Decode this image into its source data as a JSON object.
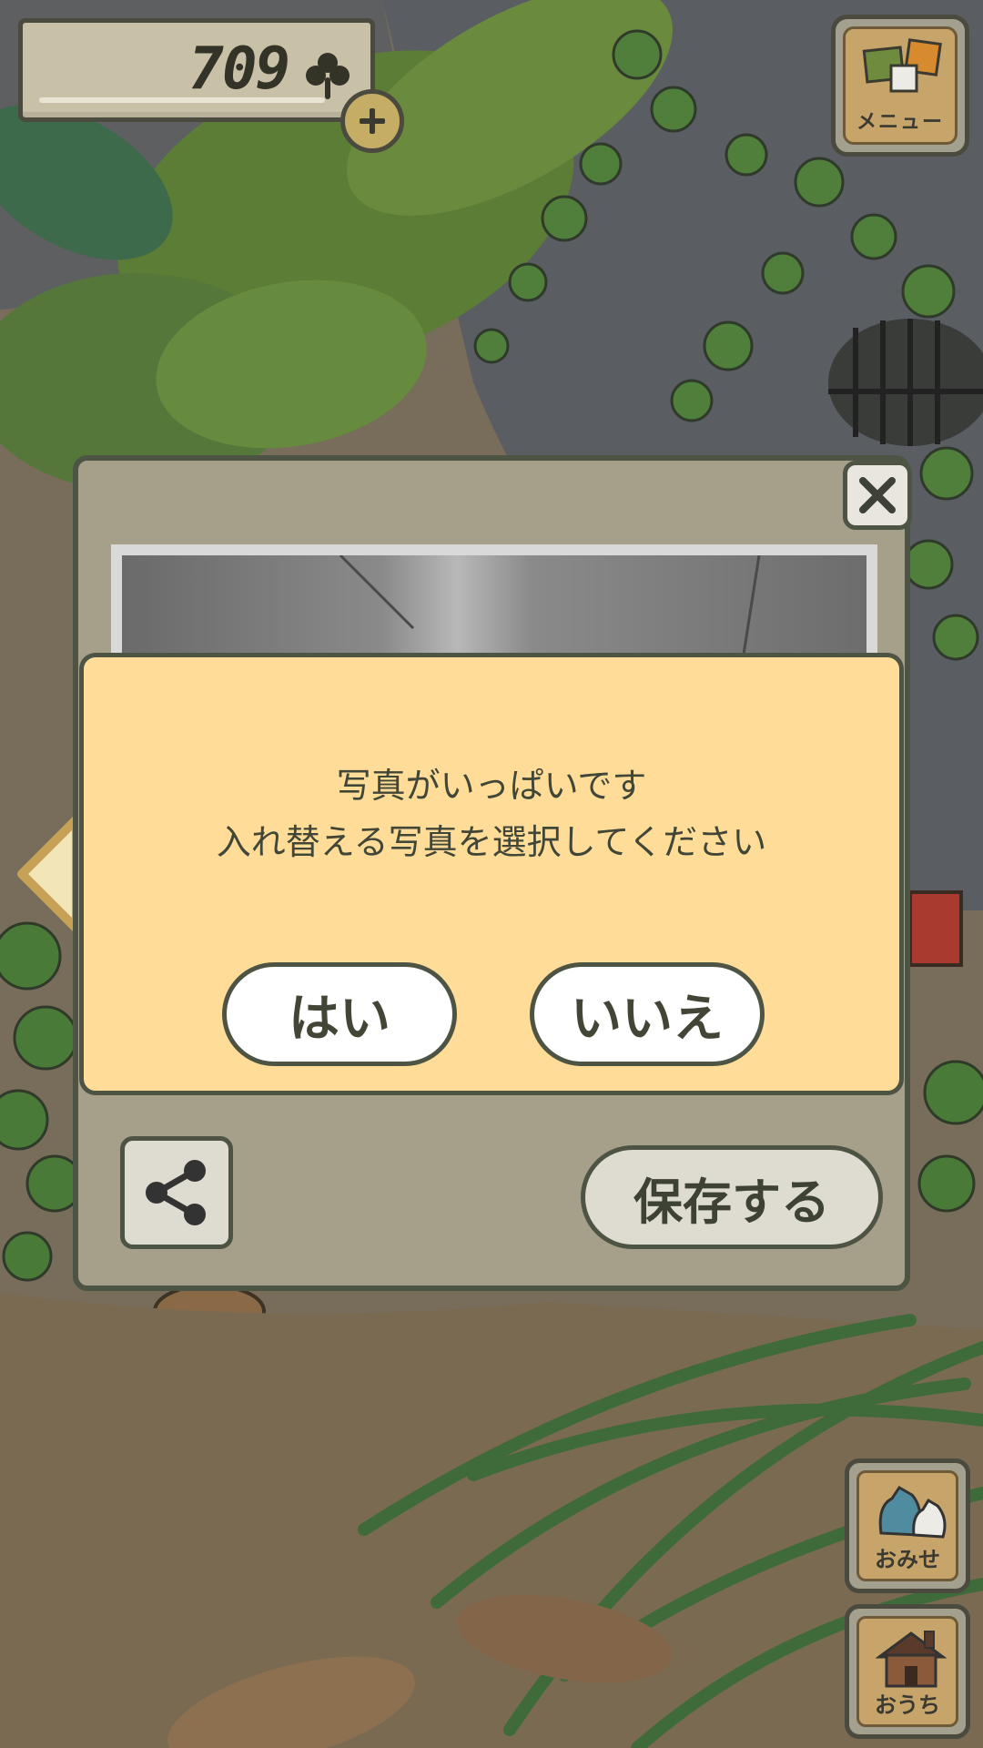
{
  "hud": {
    "clover_count": "709",
    "menu_label": "メニュー",
    "shop_label": "おみせ",
    "home_label": "おうち"
  },
  "photo_panel": {
    "save_label": "保存する"
  },
  "dialog": {
    "line1": "写真がいっぱいです",
    "line2": "入れ替える写真を選択してください",
    "yes_label": "はい",
    "no_label": "いいえ"
  },
  "colors": {
    "dialog_bg": "#ffdd99",
    "panel_bg": "#a69f8a",
    "outline": "#4e5444",
    "leaf_green": "#5f8f3c"
  },
  "icons": [
    "clover-icon",
    "plus-icon",
    "menu-icon",
    "close-icon",
    "share-icon",
    "shop-icon",
    "home-icon",
    "left-arrow-icon"
  ]
}
